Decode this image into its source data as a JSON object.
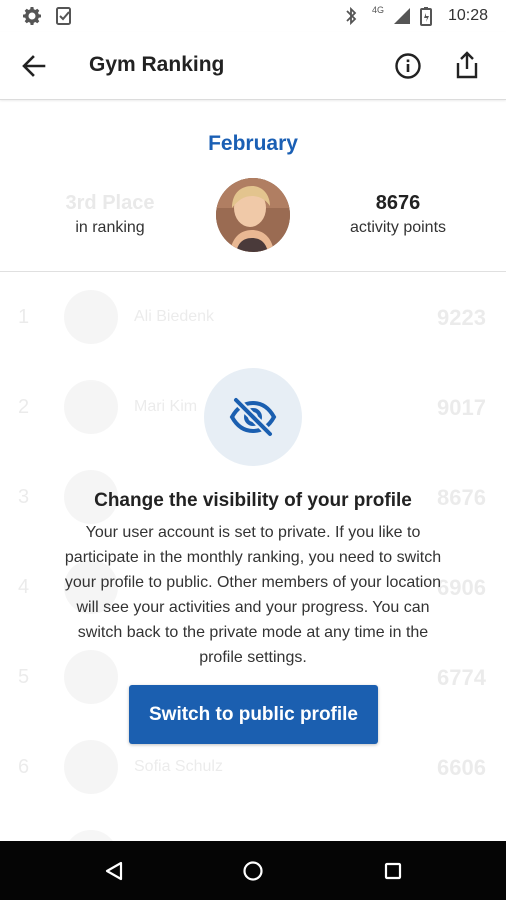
{
  "status_bar": {
    "time": "10:28",
    "network": "4G",
    "icons_left": [
      "settings-icon",
      "task-check-icon"
    ],
    "icons_right": [
      "bluetooth-icon",
      "signal-icon",
      "battery-icon"
    ]
  },
  "app_bar": {
    "title": "Gym Ranking",
    "actions": [
      "info-icon",
      "share-icon"
    ]
  },
  "summary": {
    "month": "February",
    "rank_value": "3rd Place",
    "rank_label": "in ranking",
    "points_value": "8676",
    "points_label": "activity points"
  },
  "ranking_list": [
    {
      "position": "1",
      "name": "Ali Biedenk",
      "points": "9223"
    },
    {
      "position": "2",
      "name": "Mari Kim",
      "points": "9017"
    },
    {
      "position": "3",
      "name": "",
      "points": "8676"
    },
    {
      "position": "4",
      "name": "",
      "points": "6906"
    },
    {
      "position": "5",
      "name": "",
      "points": "6774"
    },
    {
      "position": "6",
      "name": "Sofia Schulz",
      "points": "6606"
    }
  ],
  "visibility_dialog": {
    "icon": "eye-off-icon",
    "title": "Change the visibility of your profile",
    "lines": [
      "Your user account is set to private. If you like to",
      "participate in the monthly ranking, you need to switch",
      "your profile to public. Other members of your location",
      "will see your activities and your progress. You can",
      "switch back to the private mode at any time in the",
      "profile settings."
    ],
    "button_label": "Switch to public profile"
  },
  "colors": {
    "accent": "#1b5fb0",
    "month_text": "#1a5fb4",
    "icon_circle": "#e7eef5",
    "nav_bar": "#050505"
  }
}
